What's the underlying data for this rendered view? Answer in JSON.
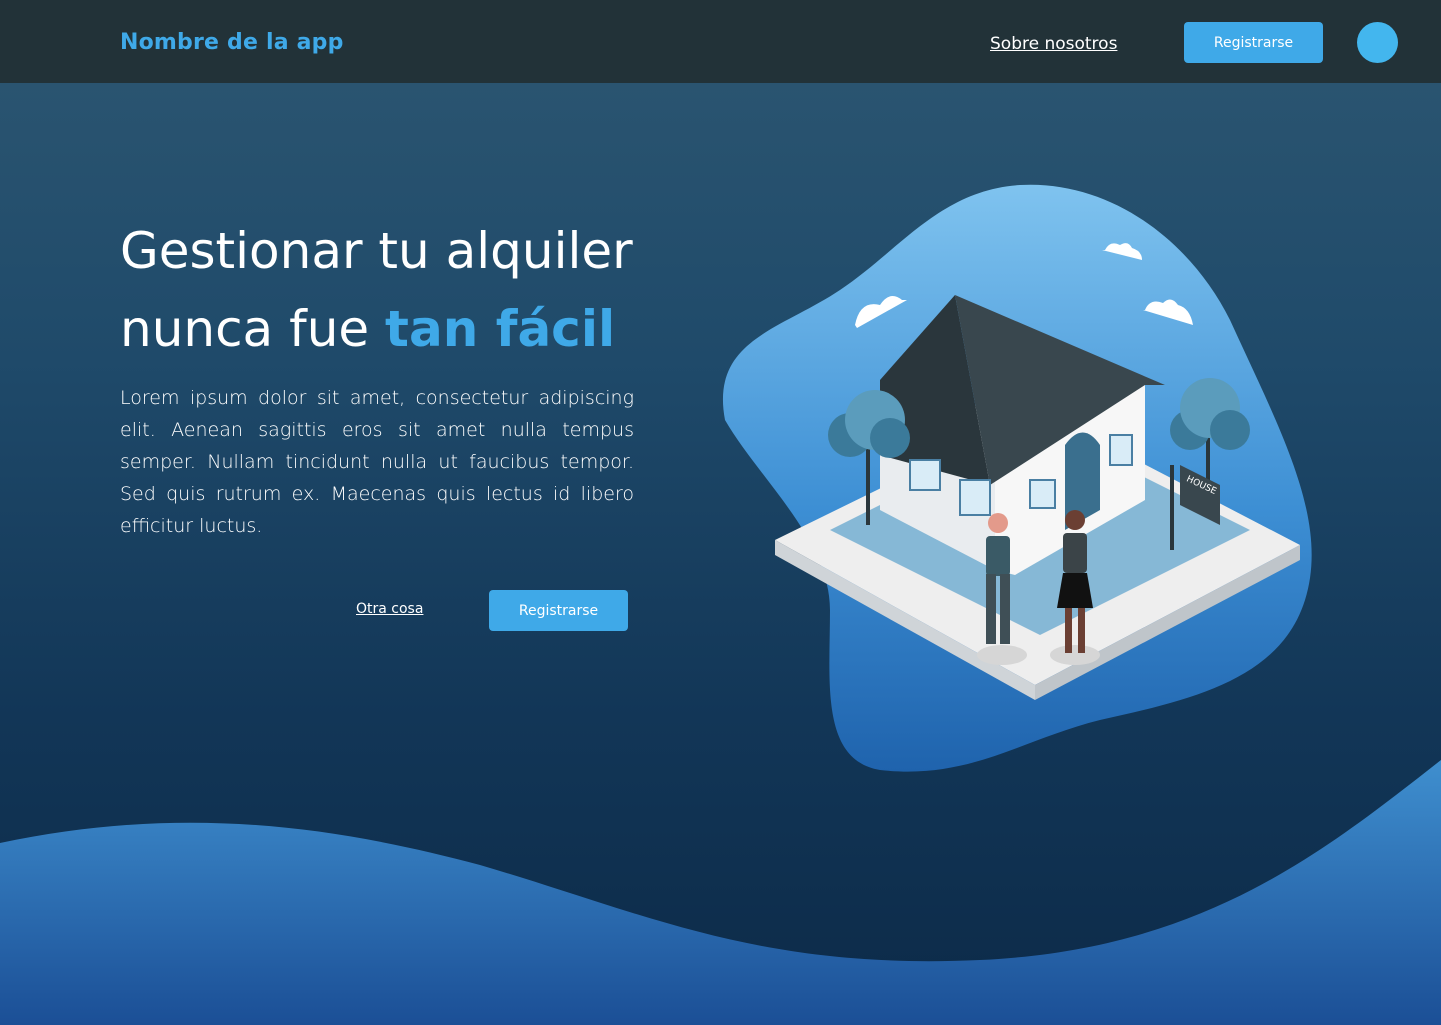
{
  "navbar": {
    "brand": "Nombre de la app",
    "about_link": "Sobre nosotros",
    "register_label": "Registrarse"
  },
  "hero": {
    "title_line1": "Gestionar tu alquiler",
    "title_line2_prefix": "nunca fue ",
    "title_line2_accent": "tan fácil",
    "body": "Lorem ipsum dolor sit amet, consectetur adipiscing elit. Aenean sagittis eros sit amet nulla tempus semper. Nullam tincidunt nulla ut faucibus tempor. Sed quis rutrum ex. Maecenas quis lectus id libero efficitur luctus.",
    "secondary_link": "Otra cosa",
    "cta_label": "Registrarse"
  },
  "illustration": {
    "sign_text": "HOUSE"
  },
  "colors": {
    "accent": "#3fa9e8",
    "navbar_bg": "#223238",
    "background_top": "#2d5772",
    "background_bottom": "#0c2a48"
  }
}
